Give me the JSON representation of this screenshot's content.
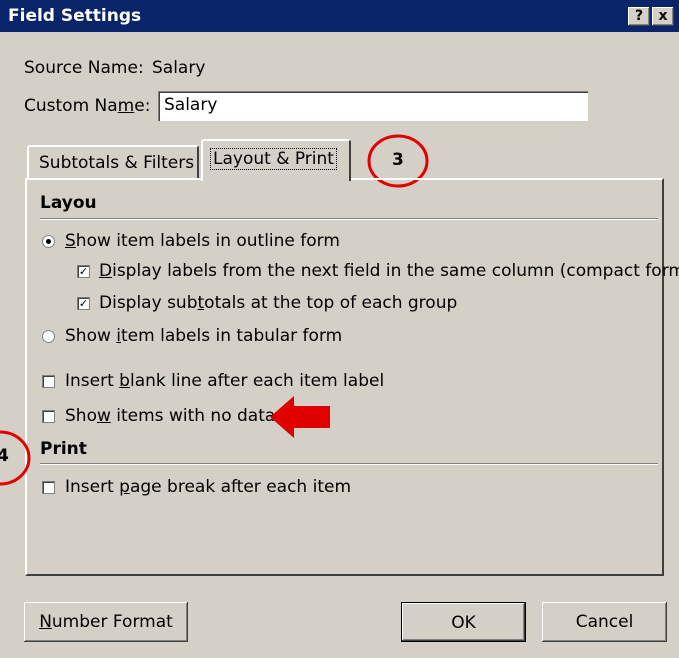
{
  "dialog": {
    "title": "Field Settings",
    "help_label": "?",
    "close_label": "x"
  },
  "source": {
    "label": "Source Name:",
    "value": "Salary"
  },
  "custom": {
    "label_pre": "Custom Na",
    "label_u": "m",
    "label_post": "e:",
    "value": "Salary"
  },
  "tabs": [
    {
      "label": "Subtotals & Filters",
      "selected": false
    },
    {
      "label": "Layout & Print",
      "selected": true
    }
  ],
  "annotations": {
    "circle_3_label": "3",
    "circle_4_label": "4",
    "accent_color": "#e00000"
  },
  "layout_section": {
    "heading": "Layou",
    "outline": {
      "u": "S",
      "rest": "how item labels in outline form",
      "selected": true
    },
    "compact": {
      "u": "D",
      "rest": "isplay labels from the next field in the same column (compact form)",
      "checked": true
    },
    "subtotals": {
      "pre": "Display sub",
      "u": "t",
      "rest": "otals at the top of each group",
      "checked": true
    },
    "tabular": {
      "pre": "Show ",
      "u": "i",
      "rest": "tem labels in tabular form",
      "selected": false
    },
    "blank_line": {
      "pre": "Insert ",
      "u": "b",
      "rest": "lank line after each item label",
      "checked": false
    },
    "no_data": {
      "pre": "Sho",
      "u": "w",
      "rest": " items with no data",
      "checked": false
    }
  },
  "print_section": {
    "heading": "Print",
    "page_break": {
      "pre": "Insert ",
      "u": "p",
      "rest": "age break after each item",
      "checked": false
    }
  },
  "buttons": {
    "number_format_u": "N",
    "number_format_rest": "umber Format",
    "ok": "OK",
    "cancel": "Cancel"
  }
}
